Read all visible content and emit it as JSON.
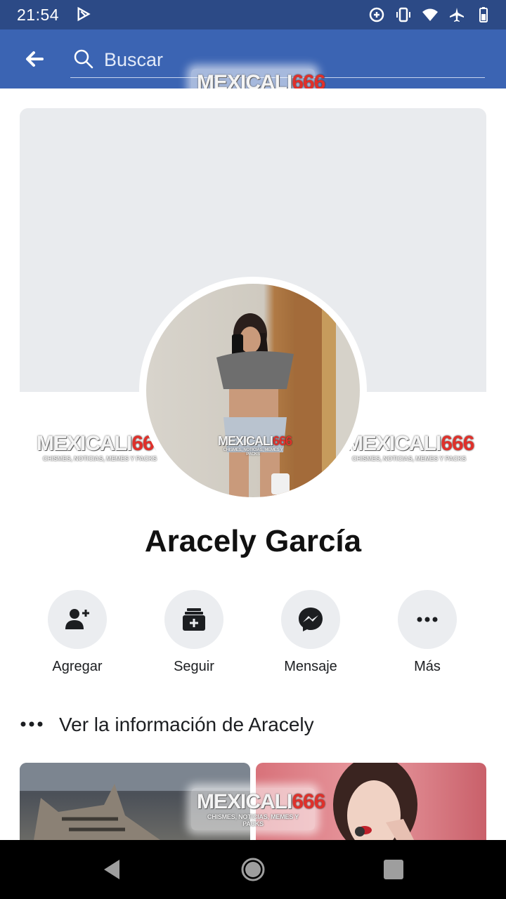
{
  "status_bar": {
    "time": "21:54",
    "icons": [
      "play-store-icon",
      "data-saver-icon",
      "vibrate-icon",
      "wifi-icon",
      "airplane-icon",
      "battery-icon"
    ]
  },
  "search": {
    "placeholder": "Buscar",
    "value": ""
  },
  "watermark": {
    "brand_text": "MEXICALI",
    "brand_number": "666",
    "tagline": "CHISMES, NOTICIAS, MEMES Y PACKS"
  },
  "profile": {
    "name": "Aracely García"
  },
  "actions": [
    {
      "label": "Agregar",
      "icon": "add-friend-icon"
    },
    {
      "label": "Seguir",
      "icon": "follow-icon"
    },
    {
      "label": "Mensaje",
      "icon": "messenger-icon"
    },
    {
      "label": "Más",
      "icon": "more-icon"
    }
  ],
  "info_link": "Ver la información de Aracely",
  "colors": {
    "status_bar": "#2c4a86",
    "app_bar": "#3b64b3",
    "button_bg": "#ebedf0",
    "text": "#1c1e21"
  }
}
